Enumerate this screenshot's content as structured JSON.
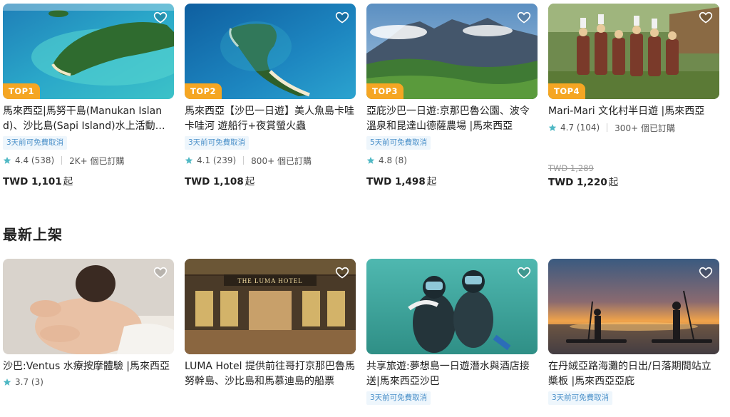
{
  "top_products": [
    {
      "rank": "TOP1",
      "title": "馬來西亞|馬努干島(Manukan Island)、沙比島(Sapi Island)水上活動體驗",
      "tag": "3天前可免費取消",
      "rating": "4.4 (538)",
      "booked": "2K+ 個已訂購",
      "original_price": "",
      "price": "TWD 1,101",
      "price_unit": "起",
      "image": "island-aerial"
    },
    {
      "rank": "TOP2",
      "title": "馬來西亞【沙巴一日遊】美人魚島卡哇卡哇河 遊船行+夜賞螢火蟲",
      "tag": "3天前可免費取消",
      "rating": "4.1 (239)",
      "booked": "800+ 個已訂購",
      "original_price": "",
      "price": "TWD 1,108",
      "price_unit": "起",
      "image": "sandbar-island"
    },
    {
      "rank": "TOP3",
      "title": "亞庇沙巴一日遊:京那巴魯公園、波令溫泉和昆達山德薩農場 |馬來西亞",
      "tag": "5天前可免費取消",
      "rating": "4.8 (8)",
      "booked": "",
      "original_price": "",
      "price": "TWD 1,498",
      "price_unit": "起",
      "image": "mountain-valley"
    },
    {
      "rank": "TOP4",
      "title": "Mari-Mari 文化村半日遊 |馬來西亞",
      "tag": "",
      "rating": "4.7 (104)",
      "booked": "300+ 個已訂購",
      "original_price": "TWD 1,289",
      "price": "TWD 1,220",
      "price_unit": "起",
      "image": "tribal-village"
    }
  ],
  "section_title": "最新上架",
  "new_products": [
    {
      "title": "沙巴:Ventus 水療按摩體驗 |馬來西亞",
      "tag": "",
      "rating": "3.7 (3)",
      "image": "spa-massage"
    },
    {
      "title": "LUMA Hotel 提供前往哥打京那巴魯馬努幹島、沙比島和馬慕迪島的船票",
      "tag": "",
      "rating": "",
      "image": "hotel-lobby",
      "sign_text": "THE LUMA HOTEL"
    },
    {
      "title": "共享旅遊:夢想島一日遊潛水與酒店接送|馬來西亞沙巴",
      "tag": "3天前可免費取消",
      "rating": "",
      "image": "scuba-divers"
    },
    {
      "title": "在丹絨亞路海灘的日出/日落期間站立槳板 |馬來西亞亞庇",
      "tag": "3天前可免費取消",
      "rating": "",
      "image": "sunset-paddleboard"
    }
  ],
  "colors": {
    "rank_badge": "#f5a623",
    "star": "#4fb8c4",
    "tag_text": "#4a90c9",
    "tag_bg": "#eef6fc"
  },
  "icons": {
    "wishlist": "heart-outline-icon",
    "rating": "star-icon"
  }
}
